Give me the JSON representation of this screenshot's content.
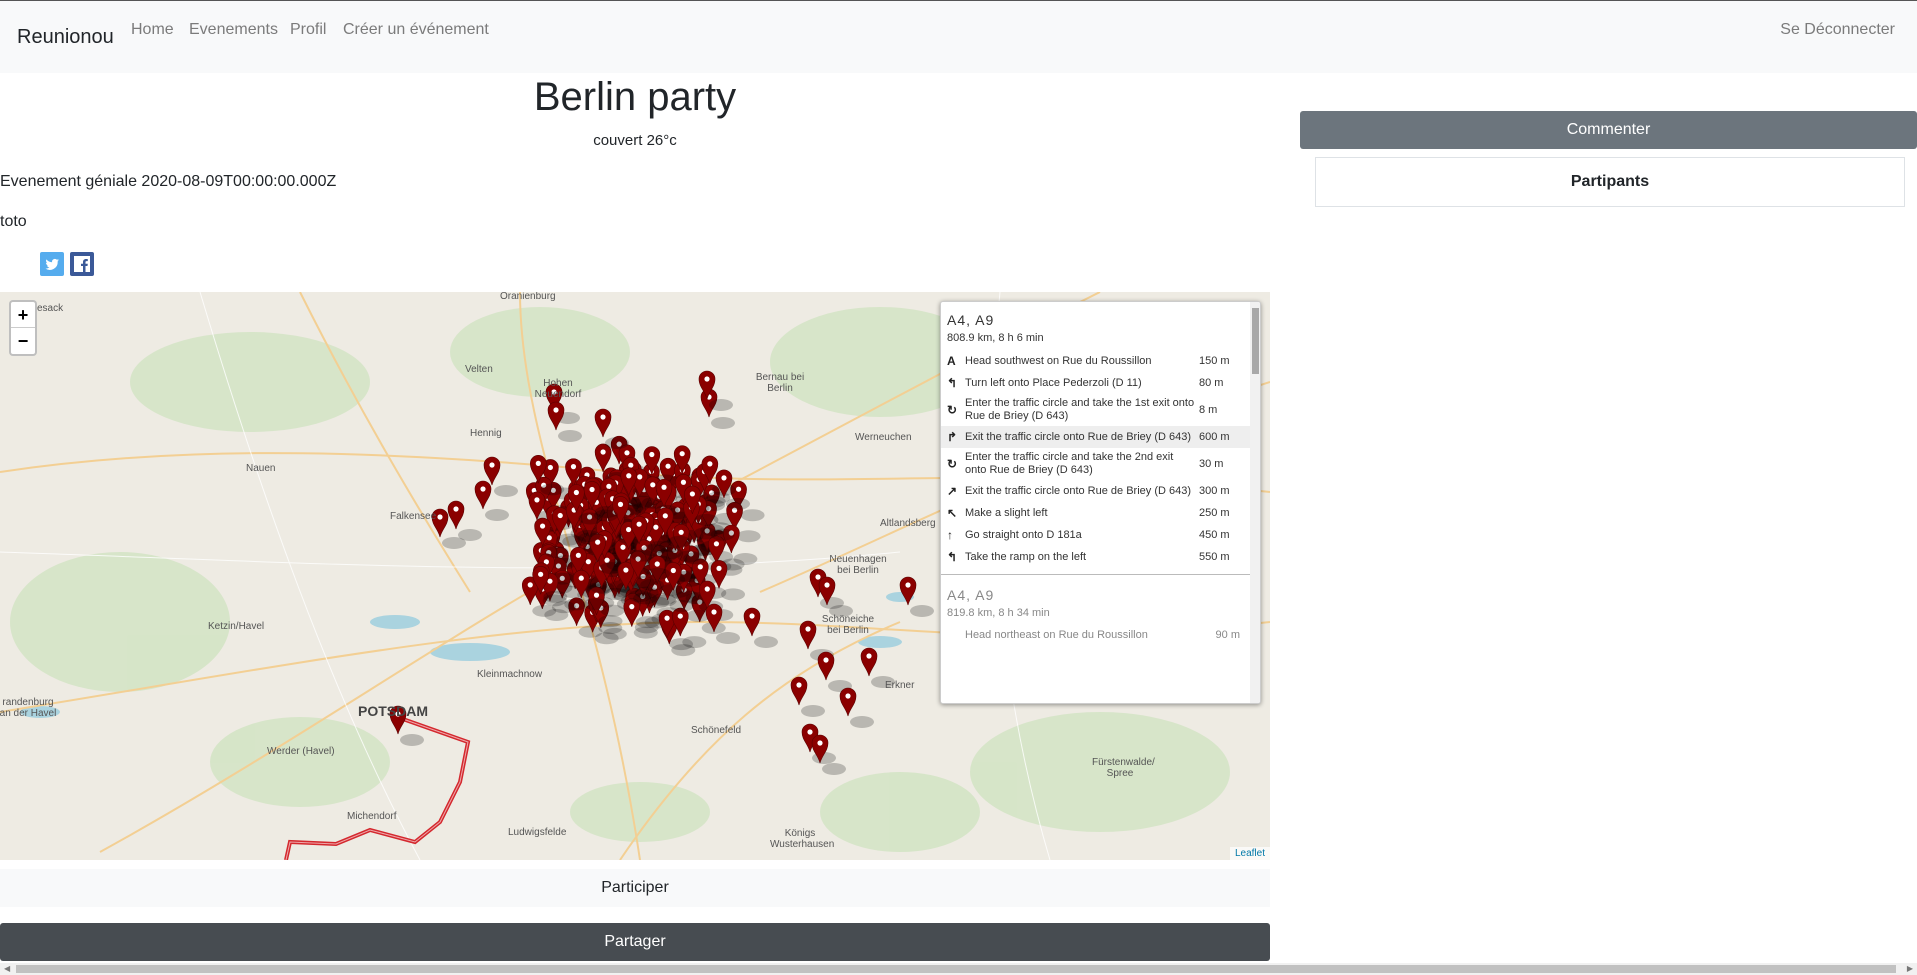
{
  "navbar": {
    "brand": "Reunionou",
    "links": [
      "Home",
      "Evenements",
      "Profil",
      "Créer un événement"
    ],
    "logout": "Se Déconnecter"
  },
  "event": {
    "title": "Berlin party",
    "weather": "couvert 26°c",
    "description": "Evenement géniale 2020-08-09T00:00:00.000Z",
    "owner": "toto"
  },
  "share_icons": [
    "twitter-icon",
    "facebook-icon"
  ],
  "map": {
    "zoom_in": "+",
    "zoom_out": "−",
    "attribution": "Leaflet",
    "marker_color": "#8b0000",
    "route_color": "#d4282e",
    "places": [
      "Oranienburg",
      "Hohen Neuendorf",
      "Bernau bei Berlin",
      "Velten",
      "Hennig",
      "Werneuchen",
      "Nauen",
      "Falkensee",
      "Altlandsberg",
      "Ketzin/Havel",
      "Neuenhagen bei Berlin",
      "Schöneiche bei Berlin",
      "POTSDAM",
      "Kleinmachnow",
      "Schönefeld",
      "Erkner",
      "Werder (Havel)",
      "Fürstenwalde/ Spree",
      "Michendorf",
      "Ludwigsfelde",
      "Königs Wusterhausen",
      "randenburg an der Havel",
      "esack"
    ]
  },
  "route": {
    "name": "A4, A9",
    "summary": "808.9 km, 8 h 6 min",
    "instructions": [
      {
        "icon": "A",
        "text": "Head southwest on Rue du Roussillon",
        "distance": "150 m"
      },
      {
        "icon": "↰",
        "text": "Turn left onto Place Pederzoli (D 11)",
        "distance": "80 m"
      },
      {
        "icon": "↻",
        "text": "Enter the traffic circle and take the 1st exit onto Rue de Briey (D 643)",
        "distance": "8 m"
      },
      {
        "icon": "↱",
        "text": "Exit the traffic circle onto Rue de Briey (D 643)",
        "distance": "600 m"
      },
      {
        "icon": "↻",
        "text": "Enter the traffic circle and take the 2nd exit onto Rue de Briey (D 643)",
        "distance": "30 m"
      },
      {
        "icon": "↗",
        "text": "Exit the traffic circle onto Rue de Briey (D 643)",
        "distance": "300 m"
      },
      {
        "icon": "↖",
        "text": "Make a slight left",
        "distance": "250 m"
      },
      {
        "icon": "↑",
        "text": "Go straight onto D 181a",
        "distance": "450 m"
      },
      {
        "icon": "↰",
        "text": "Take the ramp on the left",
        "distance": "550 m"
      }
    ],
    "alternative": {
      "name": "A4, A9",
      "summary": "819.8 km, 8 h 34 min",
      "first_instruction": "Head northeast on Rue du Roussillon",
      "first_distance": "90 m"
    }
  },
  "buttons": {
    "participer": "Participer",
    "partager": "Partager",
    "commenter": "Commenter"
  },
  "participants_title": "Partipants"
}
